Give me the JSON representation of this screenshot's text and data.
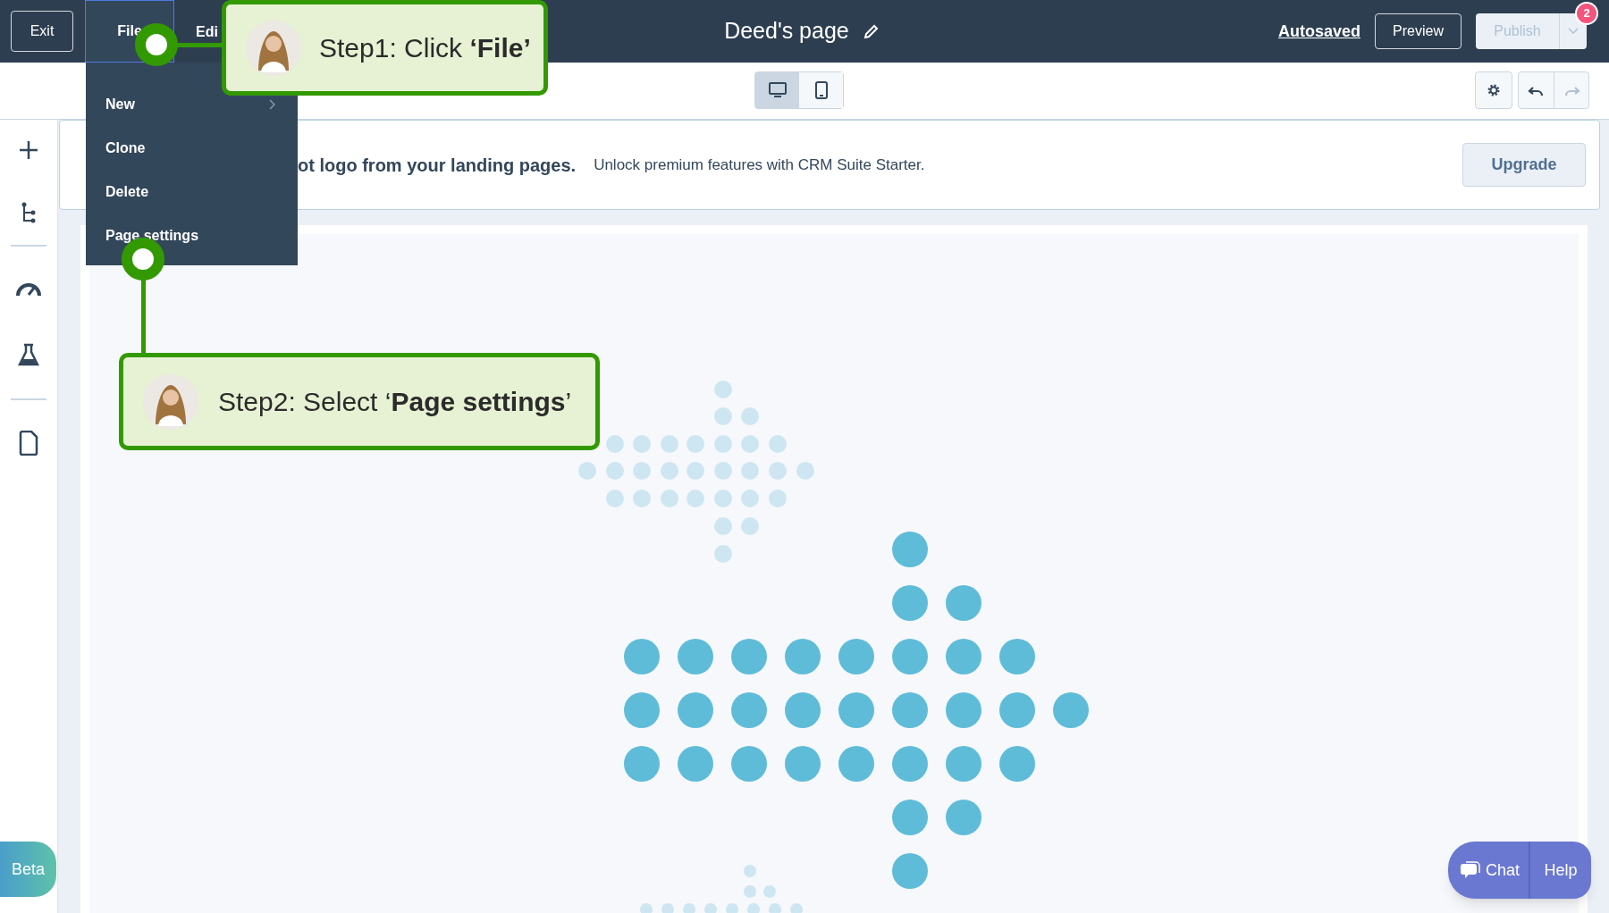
{
  "top_bar": {
    "exit": "Exit",
    "menus": [
      {
        "label": "File",
        "selected": true
      },
      {
        "label": "Edi",
        "selected": false
      }
    ],
    "title": "Deed's page",
    "autosaved": "Autosaved",
    "preview": "Preview",
    "publish": {
      "label": "Publish",
      "disabled": true
    },
    "notification_count": "2"
  },
  "toolbar": {
    "views": [
      {
        "kind": "desktop",
        "selected": true
      },
      {
        "kind": "mobile",
        "selected": false
      }
    ],
    "history": [
      {
        "kind": "undo",
        "disabled": false
      },
      {
        "kind": "redo",
        "disabled": true
      }
    ]
  },
  "file_menu": [
    {
      "label": "New",
      "submenu": true
    },
    {
      "label": "Clone",
      "submenu": false
    },
    {
      "label": "Delete",
      "submenu": false
    },
    {
      "label": "Page settings",
      "submenu": false
    }
  ],
  "banner": {
    "headline": "ot logo from your landing pages.",
    "text": "Unlock premium features with CRM Suite Starter.",
    "button": "Upgrade"
  },
  "sidebar": {
    "beta": "Beta"
  },
  "help_widget": {
    "chat": "Chat",
    "help": "Help"
  },
  "callouts": [
    {
      "text": "Step1: Click **‘File’**"
    },
    {
      "text": "Step2: Select ‘**Page settings**’"
    }
  ]
}
